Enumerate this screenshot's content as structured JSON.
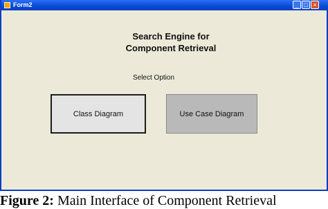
{
  "window": {
    "title": "Form2",
    "controls": {
      "minimize": "_",
      "maximize": "□",
      "close": "×"
    },
    "heading_line1": "Search Engine for",
    "heading_line2": "Component Retrieval",
    "option_label": "Select Option",
    "buttons": {
      "class_diagram": "Class  Diagram",
      "use_case_diagram": "Use Case Diagram"
    }
  },
  "caption": {
    "prefix": "Figure 2:",
    "text": " Main Interface of Component Retrieval"
  },
  "colors": {
    "titlebar": "#0a4ad6",
    "window_bg": "#ece9d8",
    "close_button": "#d9532c"
  }
}
